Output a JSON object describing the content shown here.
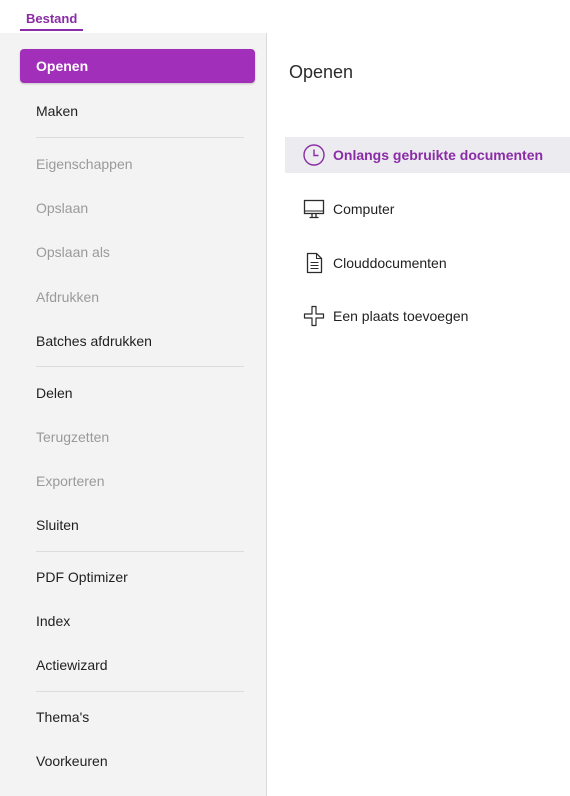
{
  "tabs": {
    "active_label": "Bestand"
  },
  "sidebar": {
    "items": [
      {
        "label": "Openen",
        "state": "active"
      },
      {
        "label": "Maken",
        "state": "enabled"
      },
      {
        "label": "Eigenschappen",
        "state": "disabled"
      },
      {
        "label": "Opslaan",
        "state": "disabled"
      },
      {
        "label": "Opslaan als",
        "state": "disabled"
      },
      {
        "label": "Afdrukken",
        "state": "disabled"
      },
      {
        "label": "Batches afdrukken",
        "state": "enabled"
      },
      {
        "label": "Delen",
        "state": "enabled"
      },
      {
        "label": "Terugzetten",
        "state": "disabled"
      },
      {
        "label": "Exporteren",
        "state": "disabled"
      },
      {
        "label": "Sluiten",
        "state": "enabled"
      },
      {
        "label": "PDF Optimizer",
        "state": "enabled"
      },
      {
        "label": "Index",
        "state": "enabled"
      },
      {
        "label": "Actiewizard",
        "state": "enabled"
      },
      {
        "label": "Thema's",
        "state": "enabled"
      },
      {
        "label": "Voorkeuren",
        "state": "enabled"
      }
    ]
  },
  "main": {
    "title": "Openen",
    "options": [
      {
        "label": "Onlangs gebruikte documenten",
        "icon": "clock-icon",
        "selected": true
      },
      {
        "label": "Computer",
        "icon": "monitor-icon",
        "selected": false
      },
      {
        "label": "Clouddocumenten",
        "icon": "document-icon",
        "selected": false
      },
      {
        "label": "Een plaats toevoegen",
        "icon": "plus-icon",
        "selected": false
      }
    ]
  },
  "colors": {
    "accent": "#a22fba",
    "accent_text": "#8a2ca6",
    "sidebar_bg": "#f3f3f4",
    "disabled_text": "#9a9a9a",
    "selected_option_bg": "#ebebf0"
  }
}
